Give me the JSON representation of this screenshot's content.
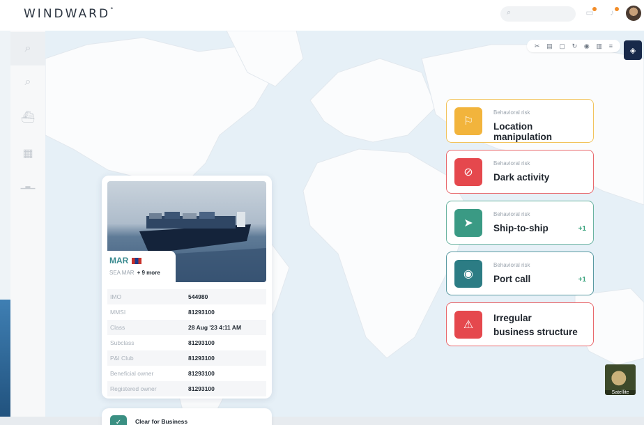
{
  "brand": {
    "logo": "WINDWARD",
    "trademark": "°"
  },
  "header": {
    "search_icon": "search-icon",
    "icons": [
      "chat-icon",
      "bell-icon"
    ],
    "accent": "#f28c28"
  },
  "sidebar": {
    "items": [
      {
        "icon": "search-icon",
        "glyph": "⌕"
      },
      {
        "icon": "search-alt-icon",
        "glyph": "⌕"
      },
      {
        "icon": "ship-icon",
        "glyph": "⛴"
      },
      {
        "icon": "grid-icon",
        "glyph": "▦"
      },
      {
        "icon": "chart-icon",
        "glyph": "▁▃▁"
      }
    ]
  },
  "map_tools": {
    "glyphs": [
      "✂",
      "▤",
      "▢",
      "↻",
      "◉",
      "▥",
      "≡"
    ],
    "layers_glyph": "◈"
  },
  "vessel": {
    "name": "MAR",
    "operator": "SEA MAR",
    "more": "+ 9 more",
    "details": [
      {
        "k": "IMO",
        "v": "544980"
      },
      {
        "k": "MMSI",
        "v": "81293100"
      },
      {
        "k": "Class",
        "v": "28 Aug '23 4:11 AM"
      },
      {
        "k": "Subclass",
        "v": "81293100"
      },
      {
        "k": "P&I Club",
        "v": "81293100"
      },
      {
        "k": "Beneficial owner",
        "v": "81293100"
      },
      {
        "k": "Registered owner",
        "v": "81293100"
      }
    ]
  },
  "status": {
    "text": "Clear for Business",
    "icon": "check-icon",
    "glyph": "✓"
  },
  "risks": [
    {
      "label": "Behavioral risk",
      "title": "Location manipulation",
      "count": "",
      "color": "#f2b43c",
      "icon": "flag-icon",
      "glyph": "⚐"
    },
    {
      "label": "Behavioral risk",
      "title": "Dark activity",
      "count": "",
      "color": "#e5484d",
      "icon": "globe-off-icon",
      "glyph": "⊘"
    },
    {
      "label": "Behavioral risk",
      "title": "Ship-to-ship",
      "count": "+1",
      "color": "#3a9a84",
      "icon": "cursor-icon",
      "glyph": "➤"
    },
    {
      "label": "Behavioral risk",
      "title": "Port call",
      "count": "+1",
      "color": "#2c7c84",
      "icon": "pin-icon",
      "glyph": "◉"
    },
    {
      "label": "",
      "title": "Irregular business structure",
      "title_line1": "Irregular",
      "title_line2": "business structure",
      "count": "",
      "color": "#e5484d",
      "icon": "warning-icon",
      "glyph": "⚠"
    }
  ],
  "satellite": {
    "label": "Satellite"
  }
}
